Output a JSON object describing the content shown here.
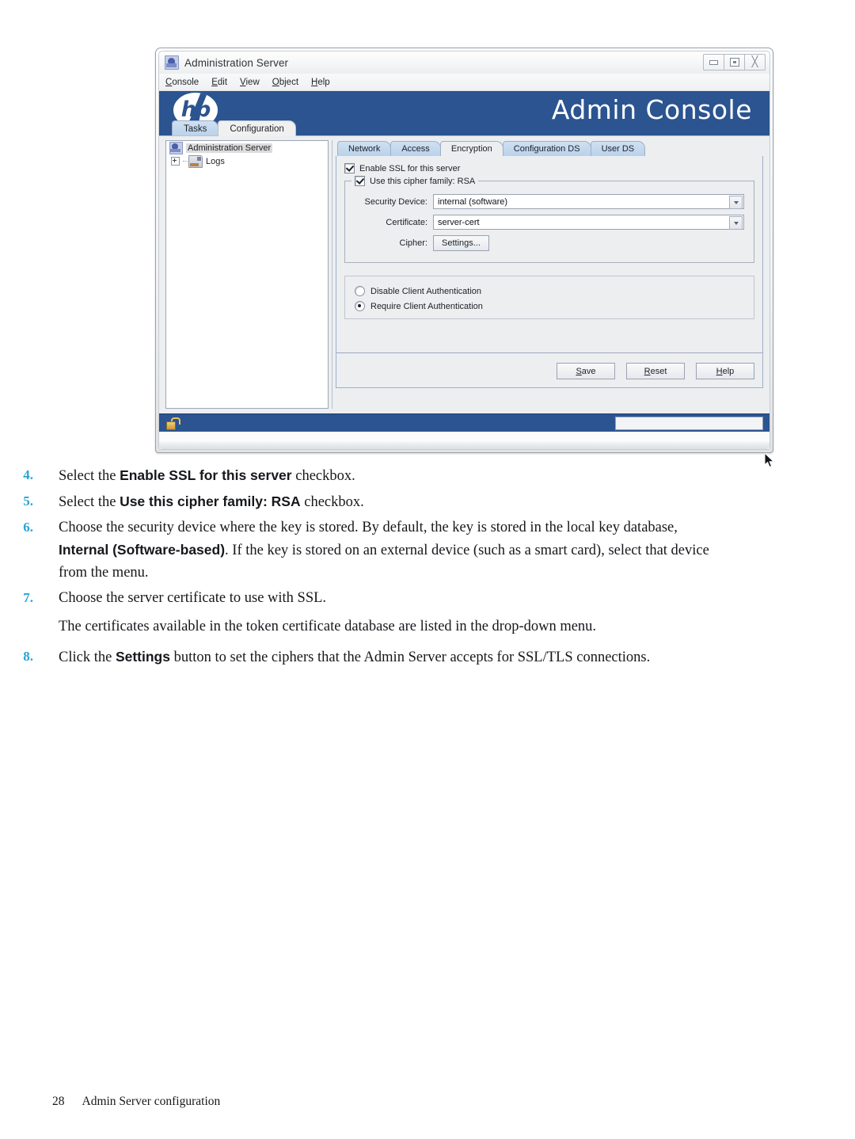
{
  "window": {
    "title": "Administration Server",
    "icon": "server-icon",
    "controls": {
      "minimize": "minimize-icon",
      "maximize": "maximize-icon",
      "close": "close-icon"
    },
    "menus": [
      {
        "label": "Console",
        "accel": "C"
      },
      {
        "label": "Edit",
        "accel": "E"
      },
      {
        "label": "View",
        "accel": "V"
      },
      {
        "label": "Object",
        "accel": "O"
      },
      {
        "label": "Help",
        "accel": "H"
      }
    ],
    "banner": {
      "logo": "hp",
      "title": "Admin Console",
      "bg": "#2b5490"
    },
    "top_tabs": [
      {
        "label": "Tasks",
        "active": false
      },
      {
        "label": "Configuration",
        "active": true
      }
    ],
    "tree": {
      "root": {
        "label": "Administration Server",
        "selected": true
      },
      "children": [
        {
          "label": "Logs",
          "expandable": true
        }
      ]
    },
    "sub_tabs": [
      {
        "label": "Network",
        "active": false
      },
      {
        "label": "Access",
        "active": false
      },
      {
        "label": "Encryption",
        "active": true
      },
      {
        "label": "Configuration DS",
        "active": false
      },
      {
        "label": "User DS",
        "active": false
      }
    ],
    "encryption": {
      "enable_ssl": {
        "label": "Enable SSL for this server",
        "checked": true
      },
      "cipher_family": {
        "label": "Use this cipher family: RSA",
        "checked": true
      },
      "security_device": {
        "label": "Security Device:",
        "value": "internal (software)"
      },
      "certificate": {
        "label": "Certificate:",
        "value": "server-cert"
      },
      "cipher": {
        "label": "Cipher:",
        "button": "Settings...",
        "accel": ""
      },
      "client_auth": [
        {
          "label": "Disable Client Authentication",
          "selected": false
        },
        {
          "label": "Require Client Authentication",
          "selected": true
        }
      ]
    },
    "buttons": [
      {
        "label": "Save",
        "accel": "S"
      },
      {
        "label": "Reset",
        "accel": "R"
      },
      {
        "label": "Help",
        "accel": "H"
      }
    ],
    "statusbar": {
      "icon": "unlocked-padlock-icon",
      "field_value": ""
    }
  },
  "doc": {
    "steps": [
      {
        "num": "4.",
        "parts": [
          {
            "t": "Select the ",
            "b": false
          },
          {
            "t": "Enable SSL for this server",
            "b": true
          },
          {
            "t": " checkbox.",
            "b": false
          }
        ]
      },
      {
        "num": "5.",
        "parts": [
          {
            "t": "Select the ",
            "b": false
          },
          {
            "t": "Use this cipher family: RSA",
            "b": true
          },
          {
            "t": " checkbox.",
            "b": false
          }
        ]
      },
      {
        "num": "6.",
        "parts": [
          {
            "t": "Choose the security device where the key is stored. By default, the key is stored in the local key database, ",
            "b": false
          },
          {
            "t": "Internal (Software-based)",
            "b": true
          },
          {
            "t": ". If the key is stored on an external device (such as a smart card), select that device from the menu.",
            "b": false
          }
        ]
      },
      {
        "num": "7.",
        "parts": [
          {
            "t": "Choose the server certificate to use with SSL.",
            "b": false
          }
        ]
      }
    ],
    "paragraph": "The certificates available in the token certificate database are listed in the drop-down menu.",
    "step8": {
      "num": "8.",
      "parts": [
        {
          "t": "Click the ",
          "b": false
        },
        {
          "t": "Settings",
          "b": true
        },
        {
          "t": " button to set the ciphers that the Admin Server accepts for SSL/TLS connections.",
          "b": false
        }
      ]
    },
    "footer": {
      "page_number": "28",
      "section": "Admin Server configuration"
    },
    "accent_color": "#2aa3d4"
  }
}
